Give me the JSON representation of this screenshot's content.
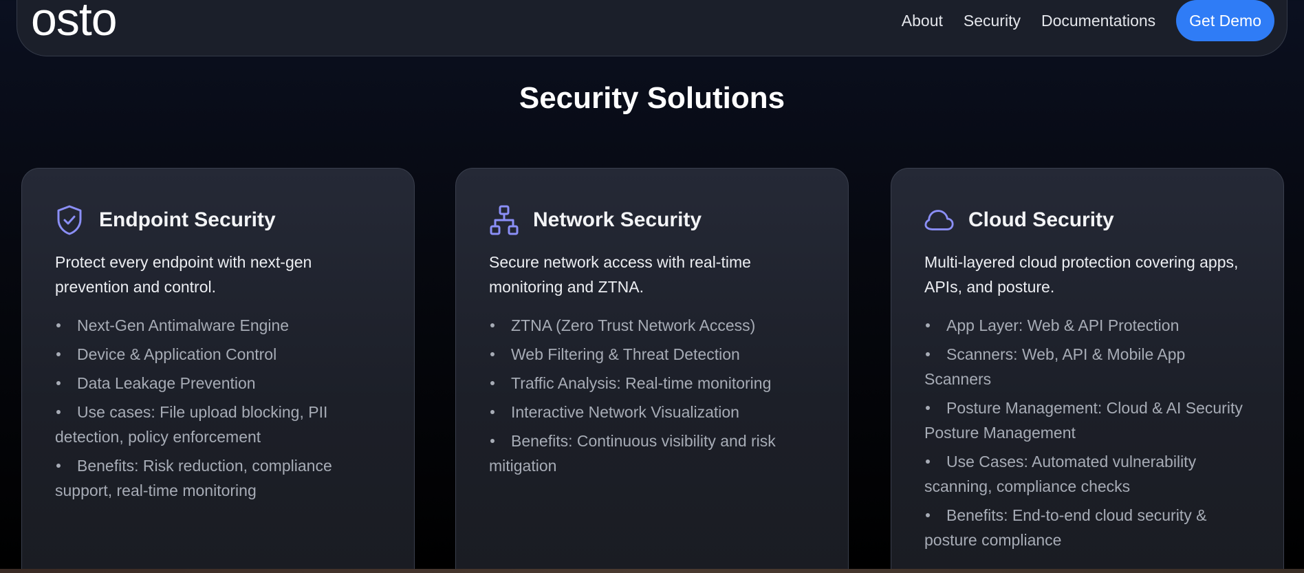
{
  "nav": {
    "logo": "osto",
    "links": [
      "About",
      "Security",
      "Documentations"
    ],
    "cta": "Get Demo"
  },
  "page": {
    "title": "Security Solutions"
  },
  "colors": {
    "accent": "#2f7cf6",
    "icon": "#8b8ff7"
  },
  "cards": [
    {
      "icon": "shield-check-icon",
      "title": "Endpoint Security",
      "description": "Protect every endpoint with next-gen prevention and control.",
      "items": [
        "Next-Gen Antimalware Engine",
        "Device & Application Control",
        "Data Leakage Prevention",
        "Use cases: File upload blocking, PII detection, policy enforcement",
        "Benefits: Risk reduction, compliance support, real-time monitoring"
      ]
    },
    {
      "icon": "network-icon",
      "title": "Network Security",
      "description": "Secure network access with real-time monitoring and ZTNA.",
      "items": [
        "ZTNA (Zero Trust Network Access)",
        "Web Filtering & Threat Detection",
        "Traffic Analysis: Real-time monitoring",
        "Interactive Network Visualization",
        "Benefits: Continuous visibility and risk mitigation"
      ]
    },
    {
      "icon": "cloud-icon",
      "title": "Cloud Security",
      "description": "Multi-layered cloud protection covering apps, APIs, and posture.",
      "items": [
        "App Layer: Web & API Protection",
        "Scanners: Web, API & Mobile App Scanners",
        "Posture Management: Cloud & AI Security Posture Management",
        "Use Cases: Automated vulnerability scanning, compliance checks",
        "Benefits: End-to-end cloud security & posture compliance"
      ]
    }
  ]
}
